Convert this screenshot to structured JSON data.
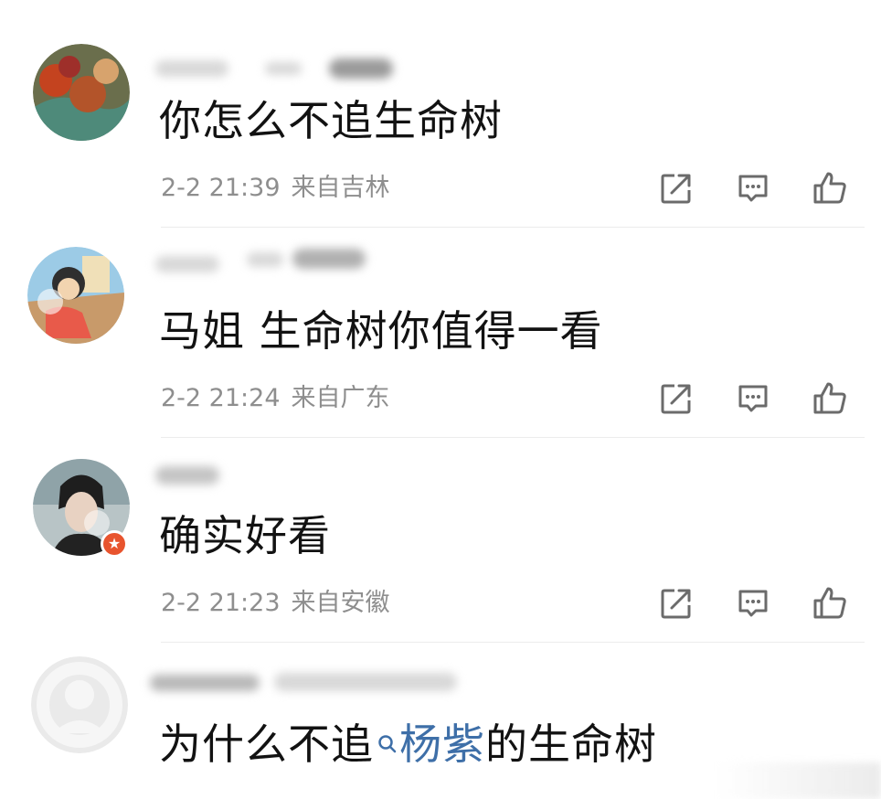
{
  "comments": [
    {
      "content": "你怎么不追生命树",
      "date": "2-2 21:39",
      "location": "来自吉林"
    },
    {
      "content": "马姐 生命树你值得一看",
      "date": "2-2 21:24",
      "location": "来自广东"
    },
    {
      "content": "确实好看",
      "date": "2-2 21:23",
      "location": "来自安徽"
    },
    {
      "content_prefix": "为什么不追",
      "content_link": "杨紫",
      "content_suffix": "的生命树"
    }
  ],
  "icons": {
    "share": "share-icon",
    "comment": "comment-icon",
    "like": "like-icon",
    "search": "search-icon"
  },
  "colors": {
    "text": "#121212",
    "meta": "#8e8e8e",
    "link": "#3e6fa8",
    "icon": "#6b6b6b"
  }
}
